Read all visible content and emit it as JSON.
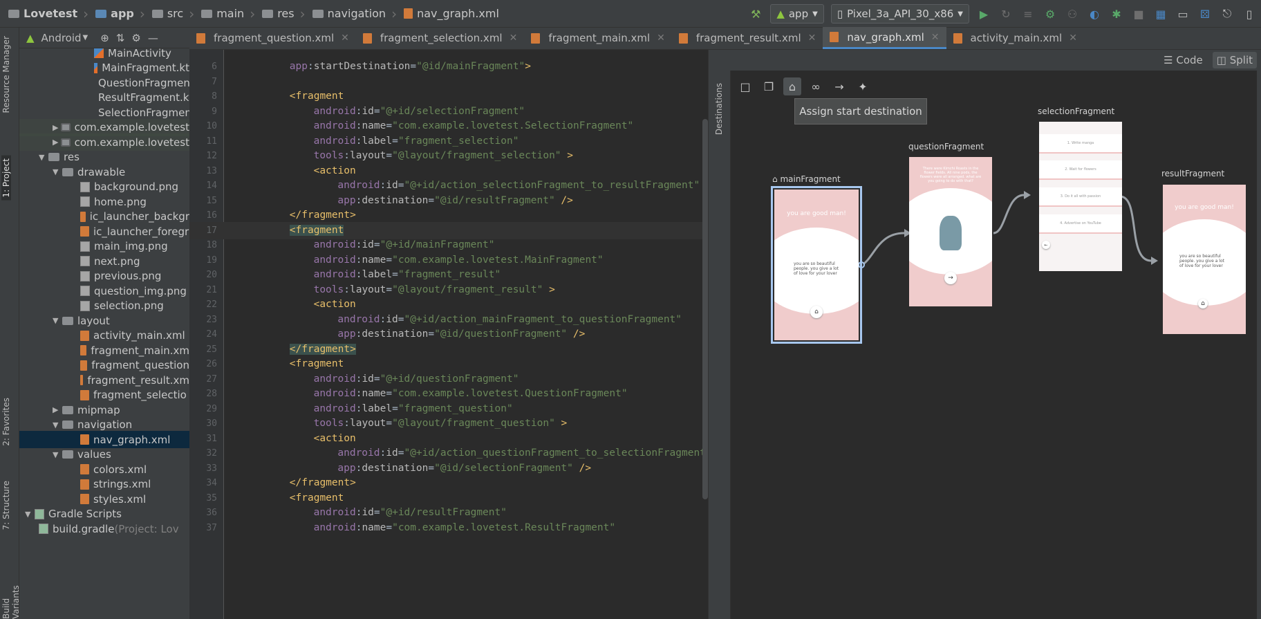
{
  "navbar": {
    "breadcrumbs": [
      "Lovetest",
      "app",
      "src",
      "main",
      "res",
      "navigation",
      "nav_graph.xml"
    ],
    "run_config": "app",
    "device": "Pixel_3a_API_30_x86"
  },
  "project_panel": {
    "view_mode": "Android"
  },
  "side_tabs": {
    "resource_manager": "Resource Manager",
    "project": "1: Project",
    "favorites": "2: Favorites",
    "structure": "7: Structure",
    "build_variants": "Build Variants",
    "destinations": "Destinations"
  },
  "tabs": [
    {
      "label": "fragment_question.xml"
    },
    {
      "label": "fragment_selection.xml"
    },
    {
      "label": "fragment_main.xml"
    },
    {
      "label": "fragment_result.xml"
    },
    {
      "label": "nav_graph.xml"
    },
    {
      "label": "activity_main.xml"
    }
  ],
  "tree": [
    {
      "label": "MainActivity",
      "indent": 5,
      "kind": "kt"
    },
    {
      "label": "MainFragment.kt",
      "indent": 5,
      "kind": "kt"
    },
    {
      "label": "QuestionFragment",
      "indent": 5,
      "kind": "kt"
    },
    {
      "label": "ResultFragment.kt",
      "indent": 5,
      "kind": "kt"
    },
    {
      "label": "SelectionFragment",
      "indent": 5,
      "kind": "kt"
    },
    {
      "label": "com.example.lovetest",
      "indent": 2,
      "kind": "pkg",
      "arrow": "▶"
    },
    {
      "label": "com.example.lovetest",
      "indent": 2,
      "kind": "pkg",
      "arrow": "▶"
    },
    {
      "label": "res",
      "indent": 1,
      "kind": "dir",
      "arrow": "▼"
    },
    {
      "label": "drawable",
      "indent": 2,
      "kind": "dir",
      "arrow": "▼"
    },
    {
      "label": "background.png",
      "indent": 4,
      "kind": "png"
    },
    {
      "label": "home.png",
      "indent": 4,
      "kind": "png"
    },
    {
      "label": "ic_launcher_backgr",
      "indent": 4,
      "kind": "xml"
    },
    {
      "label": "ic_launcher_foregr",
      "indent": 4,
      "kind": "xml"
    },
    {
      "label": "main_img.png",
      "indent": 4,
      "kind": "png"
    },
    {
      "label": "next.png",
      "indent": 4,
      "kind": "png"
    },
    {
      "label": "previous.png",
      "indent": 4,
      "kind": "png"
    },
    {
      "label": "question_img.png",
      "indent": 4,
      "kind": "png"
    },
    {
      "label": "selection.png",
      "indent": 4,
      "kind": "png"
    },
    {
      "label": "layout",
      "indent": 2,
      "kind": "dir",
      "arrow": "▼"
    },
    {
      "label": "activity_main.xml",
      "indent": 4,
      "kind": "xml"
    },
    {
      "label": "fragment_main.xm",
      "indent": 4,
      "kind": "xml"
    },
    {
      "label": "fragment_question",
      "indent": 4,
      "kind": "xml"
    },
    {
      "label": "fragment_result.xm",
      "indent": 4,
      "kind": "xml"
    },
    {
      "label": "fragment_selectio",
      "indent": 4,
      "kind": "xml"
    },
    {
      "label": "mipmap",
      "indent": 2,
      "kind": "dir",
      "arrow": "▶"
    },
    {
      "label": "navigation",
      "indent": 2,
      "kind": "dir",
      "arrow": "▼"
    },
    {
      "label": "nav_graph.xml",
      "indent": 4,
      "kind": "xml",
      "selected": true
    },
    {
      "label": "values",
      "indent": 2,
      "kind": "dir",
      "arrow": "▼"
    },
    {
      "label": "colors.xml",
      "indent": 4,
      "kind": "xml"
    },
    {
      "label": "strings.xml",
      "indent": 4,
      "kind": "xml"
    },
    {
      "label": "styles.xml",
      "indent": 4,
      "kind": "xml"
    },
    {
      "label": "Gradle Scripts",
      "indent": 0,
      "kind": "gradle",
      "arrow": "▼"
    },
    {
      "label": "build.gradle",
      "suffix": " (Project: Lov",
      "indent": 1,
      "kind": "gradle"
    }
  ],
  "code_lines": [
    {
      "n": "6",
      "indent": 4,
      "parts": [
        [
          "ns",
          "app"
        ],
        [
          "pl",
          ":"
        ],
        [
          "at",
          "startDestination"
        ],
        [
          "pl",
          "="
        ],
        [
          "val",
          "\"@id/mainFragment\""
        ],
        [
          "tag",
          ">"
        ]
      ]
    },
    {
      "n": "7",
      "indent": 0,
      "parts": []
    },
    {
      "n": "8",
      "indent": 4,
      "parts": [
        [
          "tag",
          "<fragment"
        ]
      ]
    },
    {
      "n": "9",
      "indent": 8,
      "parts": [
        [
          "ns",
          "android"
        ],
        [
          "pl",
          ":"
        ],
        [
          "at",
          "id"
        ],
        [
          "pl",
          "="
        ],
        [
          "val",
          "\"@+id/selectionFragment\""
        ]
      ]
    },
    {
      "n": "10",
      "indent": 8,
      "parts": [
        [
          "ns",
          "android"
        ],
        [
          "pl",
          ":"
        ],
        [
          "at",
          "name"
        ],
        [
          "pl",
          "="
        ],
        [
          "val",
          "\"com.example.lovetest.SelectionFragment\""
        ]
      ]
    },
    {
      "n": "11",
      "indent": 8,
      "parts": [
        [
          "ns",
          "android"
        ],
        [
          "pl",
          ":"
        ],
        [
          "at",
          "label"
        ],
        [
          "pl",
          "="
        ],
        [
          "val",
          "\"fragment_selection\""
        ]
      ]
    },
    {
      "n": "12",
      "indent": 8,
      "parts": [
        [
          "ns",
          "tools"
        ],
        [
          "pl",
          ":"
        ],
        [
          "at",
          "layout"
        ],
        [
          "pl",
          "="
        ],
        [
          "val",
          "\"@layout/fragment_selection\""
        ],
        [
          "tag",
          " >"
        ]
      ]
    },
    {
      "n": "13",
      "indent": 8,
      "parts": [
        [
          "tag",
          "<action"
        ]
      ]
    },
    {
      "n": "14",
      "indent": 12,
      "parts": [
        [
          "ns",
          "android"
        ],
        [
          "pl",
          ":"
        ],
        [
          "at",
          "id"
        ],
        [
          "pl",
          "="
        ],
        [
          "val",
          "\"@+id/action_selectionFragment_to_resultFragment\""
        ]
      ]
    },
    {
      "n": "15",
      "indent": 12,
      "parts": [
        [
          "ns",
          "app"
        ],
        [
          "pl",
          ":"
        ],
        [
          "at",
          "destination"
        ],
        [
          "pl",
          "="
        ],
        [
          "val",
          "\"@id/resultFragment\""
        ],
        [
          "tag",
          " />"
        ]
      ]
    },
    {
      "n": "16",
      "indent": 4,
      "parts": [
        [
          "tag",
          "</fragment>"
        ]
      ]
    },
    {
      "n": "17",
      "indent": 4,
      "parts": [
        [
          "tagm",
          "<fragment"
        ]
      ],
      "current": true
    },
    {
      "n": "18",
      "indent": 8,
      "parts": [
        [
          "ns",
          "android"
        ],
        [
          "pl",
          ":"
        ],
        [
          "at",
          "id"
        ],
        [
          "pl",
          "="
        ],
        [
          "val",
          "\"@+id/mainFragment\""
        ]
      ]
    },
    {
      "n": "19",
      "indent": 8,
      "parts": [
        [
          "ns",
          "android"
        ],
        [
          "pl",
          ":"
        ],
        [
          "at",
          "name"
        ],
        [
          "pl",
          "="
        ],
        [
          "val",
          "\"com.example.lovetest.MainFragment\""
        ]
      ]
    },
    {
      "n": "20",
      "indent": 8,
      "parts": [
        [
          "ns",
          "android"
        ],
        [
          "pl",
          ":"
        ],
        [
          "at",
          "label"
        ],
        [
          "pl",
          "="
        ],
        [
          "val",
          "\"fragment_result\""
        ]
      ]
    },
    {
      "n": "21",
      "indent": 8,
      "parts": [
        [
          "ns",
          "tools"
        ],
        [
          "pl",
          ":"
        ],
        [
          "at",
          "layout"
        ],
        [
          "pl",
          "="
        ],
        [
          "val",
          "\"@layout/fragment_result\""
        ],
        [
          "tag",
          " >"
        ]
      ]
    },
    {
      "n": "22",
      "indent": 8,
      "parts": [
        [
          "tag",
          "<action"
        ]
      ]
    },
    {
      "n": "23",
      "indent": 12,
      "parts": [
        [
          "ns",
          "android"
        ],
        [
          "pl",
          ":"
        ],
        [
          "at",
          "id"
        ],
        [
          "pl",
          "="
        ],
        [
          "val",
          "\"@+id/action_mainFragment_to_questionFragment\""
        ]
      ]
    },
    {
      "n": "24",
      "indent": 12,
      "parts": [
        [
          "ns",
          "app"
        ],
        [
          "pl",
          ":"
        ],
        [
          "at",
          "destination"
        ],
        [
          "pl",
          "="
        ],
        [
          "val",
          "\"@id/questionFragment\""
        ],
        [
          "tag",
          " />"
        ]
      ]
    },
    {
      "n": "25",
      "indent": 4,
      "parts": [
        [
          "tagm",
          "</fragment>"
        ]
      ]
    },
    {
      "n": "26",
      "indent": 4,
      "parts": [
        [
          "tag",
          "<fragment"
        ]
      ]
    },
    {
      "n": "27",
      "indent": 8,
      "parts": [
        [
          "ns",
          "android"
        ],
        [
          "pl",
          ":"
        ],
        [
          "at",
          "id"
        ],
        [
          "pl",
          "="
        ],
        [
          "val",
          "\"@+id/questionFragment\""
        ]
      ]
    },
    {
      "n": "28",
      "indent": 8,
      "parts": [
        [
          "ns",
          "android"
        ],
        [
          "pl",
          ":"
        ],
        [
          "at",
          "name"
        ],
        [
          "pl",
          "="
        ],
        [
          "val",
          "\"com.example.lovetest.QuestionFragment\""
        ]
      ]
    },
    {
      "n": "29",
      "indent": 8,
      "parts": [
        [
          "ns",
          "android"
        ],
        [
          "pl",
          ":"
        ],
        [
          "at",
          "label"
        ],
        [
          "pl",
          "="
        ],
        [
          "val",
          "\"fragment_question\""
        ]
      ]
    },
    {
      "n": "30",
      "indent": 8,
      "parts": [
        [
          "ns",
          "tools"
        ],
        [
          "pl",
          ":"
        ],
        [
          "at",
          "layout"
        ],
        [
          "pl",
          "="
        ],
        [
          "val",
          "\"@layout/fragment_question\""
        ],
        [
          "tag",
          " >"
        ]
      ]
    },
    {
      "n": "31",
      "indent": 8,
      "parts": [
        [
          "tag",
          "<action"
        ]
      ]
    },
    {
      "n": "32",
      "indent": 12,
      "parts": [
        [
          "ns",
          "android"
        ],
        [
          "pl",
          ":"
        ],
        [
          "at",
          "id"
        ],
        [
          "pl",
          "="
        ],
        [
          "val",
          "\"@+id/action_questionFragment_to_selectionFragment\""
        ]
      ]
    },
    {
      "n": "33",
      "indent": 12,
      "parts": [
        [
          "ns",
          "app"
        ],
        [
          "pl",
          ":"
        ],
        [
          "at",
          "destination"
        ],
        [
          "pl",
          "="
        ],
        [
          "val",
          "\"@id/selectionFragment\""
        ],
        [
          "tag",
          " />"
        ]
      ]
    },
    {
      "n": "34",
      "indent": 4,
      "parts": [
        [
          "tag",
          "</fragment>"
        ]
      ]
    },
    {
      "n": "35",
      "indent": 4,
      "parts": [
        [
          "tag",
          "<fragment"
        ]
      ]
    },
    {
      "n": "36",
      "indent": 8,
      "parts": [
        [
          "ns",
          "android"
        ],
        [
          "pl",
          ":"
        ],
        [
          "at",
          "id"
        ],
        [
          "pl",
          "="
        ],
        [
          "val",
          "\"@+id/resultFragment\""
        ]
      ]
    },
    {
      "n": "37",
      "indent": 8,
      "parts": [
        [
          "ns",
          "android"
        ],
        [
          "pl",
          ":"
        ],
        [
          "at",
          "name"
        ],
        [
          "pl",
          "="
        ],
        [
          "val",
          "\"com.example.lovetest.ResultFragment\""
        ]
      ]
    }
  ],
  "design": {
    "code_label": "Code",
    "split_label": "Split",
    "tooltip": "Assign start destination",
    "destinations": {
      "main": {
        "name": "mainFragment",
        "title": "you are good man!",
        "body": "you are so beautiful people. you give a lot of love for your lover"
      },
      "question": {
        "name": "questionFragment",
        "title": "There were Kimchi Roasts in the flower fields. All nine pods, the flowers were all arranged. what are you going to do with that?"
      },
      "selection": {
        "name": "selectionFragment",
        "options": [
          "1. Write manga",
          "2. Wait for flowers",
          "3. Do it all with passion",
          "4. Advertise on YouTube"
        ]
      },
      "result": {
        "name": "resultFragment",
        "title": "you are good man!",
        "body": "you are so beautiful people. you give a lot of love for your lover"
      }
    }
  }
}
